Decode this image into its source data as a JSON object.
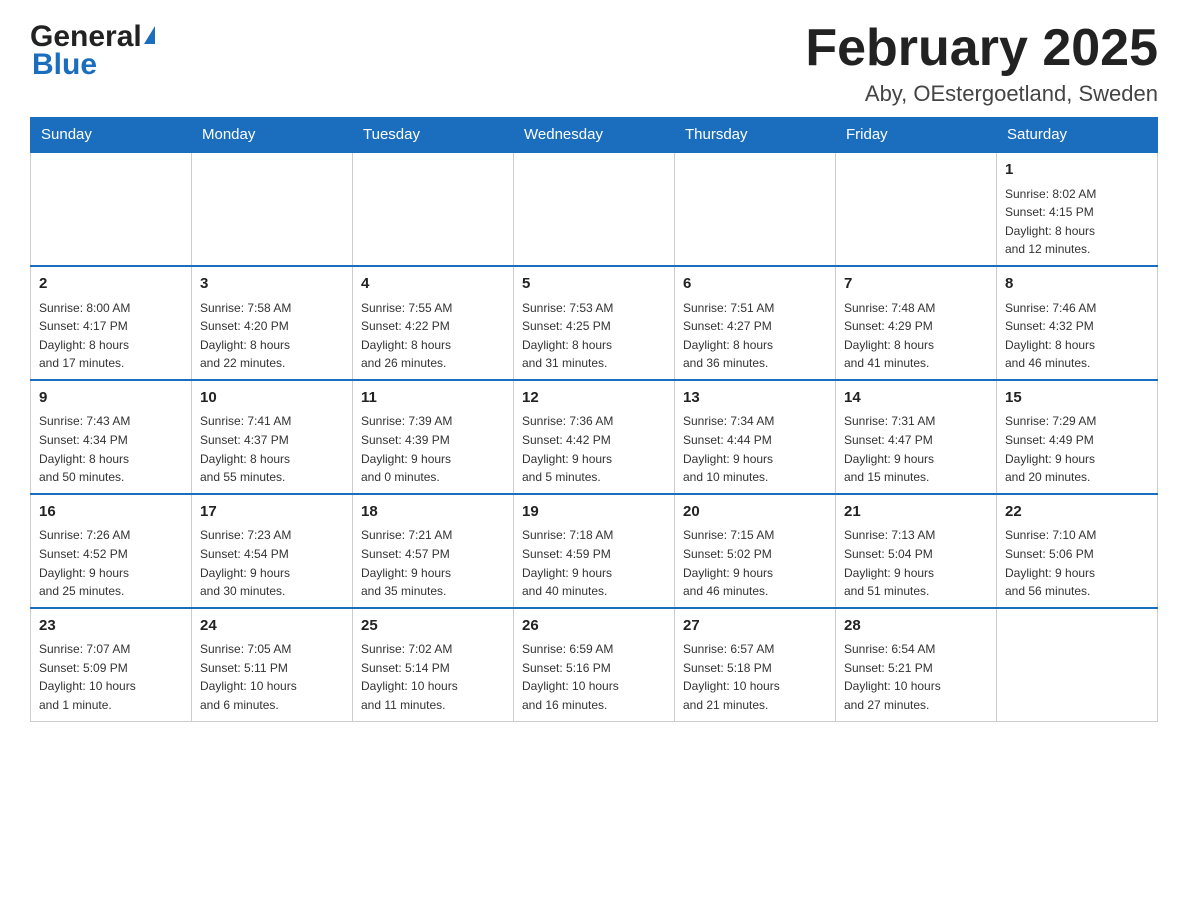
{
  "header": {
    "logo_general": "General",
    "logo_blue": "Blue",
    "month_title": "February 2025",
    "location": "Aby, OEstergoetland, Sweden"
  },
  "weekdays": [
    "Sunday",
    "Monday",
    "Tuesday",
    "Wednesday",
    "Thursday",
    "Friday",
    "Saturday"
  ],
  "weeks": [
    [
      {
        "day": "",
        "info": ""
      },
      {
        "day": "",
        "info": ""
      },
      {
        "day": "",
        "info": ""
      },
      {
        "day": "",
        "info": ""
      },
      {
        "day": "",
        "info": ""
      },
      {
        "day": "",
        "info": ""
      },
      {
        "day": "1",
        "info": "Sunrise: 8:02 AM\nSunset: 4:15 PM\nDaylight: 8 hours\nand 12 minutes."
      }
    ],
    [
      {
        "day": "2",
        "info": "Sunrise: 8:00 AM\nSunset: 4:17 PM\nDaylight: 8 hours\nand 17 minutes."
      },
      {
        "day": "3",
        "info": "Sunrise: 7:58 AM\nSunset: 4:20 PM\nDaylight: 8 hours\nand 22 minutes."
      },
      {
        "day": "4",
        "info": "Sunrise: 7:55 AM\nSunset: 4:22 PM\nDaylight: 8 hours\nand 26 minutes."
      },
      {
        "day": "5",
        "info": "Sunrise: 7:53 AM\nSunset: 4:25 PM\nDaylight: 8 hours\nand 31 minutes."
      },
      {
        "day": "6",
        "info": "Sunrise: 7:51 AM\nSunset: 4:27 PM\nDaylight: 8 hours\nand 36 minutes."
      },
      {
        "day": "7",
        "info": "Sunrise: 7:48 AM\nSunset: 4:29 PM\nDaylight: 8 hours\nand 41 minutes."
      },
      {
        "day": "8",
        "info": "Sunrise: 7:46 AM\nSunset: 4:32 PM\nDaylight: 8 hours\nand 46 minutes."
      }
    ],
    [
      {
        "day": "9",
        "info": "Sunrise: 7:43 AM\nSunset: 4:34 PM\nDaylight: 8 hours\nand 50 minutes."
      },
      {
        "day": "10",
        "info": "Sunrise: 7:41 AM\nSunset: 4:37 PM\nDaylight: 8 hours\nand 55 minutes."
      },
      {
        "day": "11",
        "info": "Sunrise: 7:39 AM\nSunset: 4:39 PM\nDaylight: 9 hours\nand 0 minutes."
      },
      {
        "day": "12",
        "info": "Sunrise: 7:36 AM\nSunset: 4:42 PM\nDaylight: 9 hours\nand 5 minutes."
      },
      {
        "day": "13",
        "info": "Sunrise: 7:34 AM\nSunset: 4:44 PM\nDaylight: 9 hours\nand 10 minutes."
      },
      {
        "day": "14",
        "info": "Sunrise: 7:31 AM\nSunset: 4:47 PM\nDaylight: 9 hours\nand 15 minutes."
      },
      {
        "day": "15",
        "info": "Sunrise: 7:29 AM\nSunset: 4:49 PM\nDaylight: 9 hours\nand 20 minutes."
      }
    ],
    [
      {
        "day": "16",
        "info": "Sunrise: 7:26 AM\nSunset: 4:52 PM\nDaylight: 9 hours\nand 25 minutes."
      },
      {
        "day": "17",
        "info": "Sunrise: 7:23 AM\nSunset: 4:54 PM\nDaylight: 9 hours\nand 30 minutes."
      },
      {
        "day": "18",
        "info": "Sunrise: 7:21 AM\nSunset: 4:57 PM\nDaylight: 9 hours\nand 35 minutes."
      },
      {
        "day": "19",
        "info": "Sunrise: 7:18 AM\nSunset: 4:59 PM\nDaylight: 9 hours\nand 40 minutes."
      },
      {
        "day": "20",
        "info": "Sunrise: 7:15 AM\nSunset: 5:02 PM\nDaylight: 9 hours\nand 46 minutes."
      },
      {
        "day": "21",
        "info": "Sunrise: 7:13 AM\nSunset: 5:04 PM\nDaylight: 9 hours\nand 51 minutes."
      },
      {
        "day": "22",
        "info": "Sunrise: 7:10 AM\nSunset: 5:06 PM\nDaylight: 9 hours\nand 56 minutes."
      }
    ],
    [
      {
        "day": "23",
        "info": "Sunrise: 7:07 AM\nSunset: 5:09 PM\nDaylight: 10 hours\nand 1 minute."
      },
      {
        "day": "24",
        "info": "Sunrise: 7:05 AM\nSunset: 5:11 PM\nDaylight: 10 hours\nand 6 minutes."
      },
      {
        "day": "25",
        "info": "Sunrise: 7:02 AM\nSunset: 5:14 PM\nDaylight: 10 hours\nand 11 minutes."
      },
      {
        "day": "26",
        "info": "Sunrise: 6:59 AM\nSunset: 5:16 PM\nDaylight: 10 hours\nand 16 minutes."
      },
      {
        "day": "27",
        "info": "Sunrise: 6:57 AM\nSunset: 5:18 PM\nDaylight: 10 hours\nand 21 minutes."
      },
      {
        "day": "28",
        "info": "Sunrise: 6:54 AM\nSunset: 5:21 PM\nDaylight: 10 hours\nand 27 minutes."
      },
      {
        "day": "",
        "info": ""
      }
    ]
  ]
}
